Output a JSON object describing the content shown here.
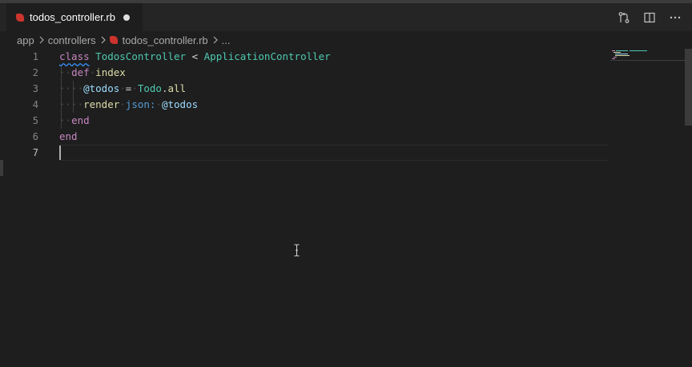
{
  "tab": {
    "title": "todos_controller.rb",
    "file_icon": "ruby-icon",
    "dirty_icon": "unsaved-dot-icon"
  },
  "toolbar": {
    "icons": [
      "open-changes-icon",
      "split-editor-icon",
      "more-actions-icon"
    ]
  },
  "breadcrumbs": {
    "items": [
      "app",
      "controllers",
      "todos_controller.rb",
      "..."
    ],
    "separator_icon": "chevron-right-icon"
  },
  "editor": {
    "line_numbers": [
      "1",
      "2",
      "3",
      "4",
      "5",
      "6",
      "7"
    ],
    "active_line": "7",
    "lines": [
      [
        {
          "t": "class",
          "c": "kw kw-squiggle"
        },
        {
          "t": " ",
          "c": "ws"
        },
        {
          "t": "TodosController",
          "c": "cls"
        },
        {
          "t": " ",
          "c": "ws"
        },
        {
          "t": "<",
          "c": "op"
        },
        {
          "t": " ",
          "c": "ws"
        },
        {
          "t": "ApplicationController",
          "c": "cls"
        }
      ],
      [
        {
          "t": "··",
          "c": "ws"
        },
        {
          "t": "def",
          "c": "kw"
        },
        {
          "t": "·",
          "c": "ws"
        },
        {
          "t": "index",
          "c": "fn"
        }
      ],
      [
        {
          "t": "····",
          "c": "ws"
        },
        {
          "t": "@todos",
          "c": "ivar"
        },
        {
          "t": "·",
          "c": "ws"
        },
        {
          "t": "=",
          "c": "op"
        },
        {
          "t": "·",
          "c": "ws"
        },
        {
          "t": "Todo",
          "c": "cls"
        },
        {
          "t": ".",
          "c": "plain"
        },
        {
          "t": "all",
          "c": "fn"
        }
      ],
      [
        {
          "t": "····",
          "c": "ws"
        },
        {
          "t": "render",
          "c": "fn"
        },
        {
          "t": "·",
          "c": "ws"
        },
        {
          "t": "json:",
          "c": "sym"
        },
        {
          "t": "·",
          "c": "ws"
        },
        {
          "t": "@todos",
          "c": "ivar"
        }
      ],
      [
        {
          "t": "··",
          "c": "ws"
        },
        {
          "t": "end",
          "c": "kw"
        }
      ],
      [
        {
          "t": "end",
          "c": "kw"
        }
      ],
      []
    ]
  },
  "colors": {
    "editor_bg": "#1e1e1e",
    "tabbar_bg": "#252526",
    "keyword": "#c586c0",
    "class_name": "#4ec9b0",
    "function": "#dcdcaa",
    "ivar": "#9cdcfe",
    "symbol": "#569cd6",
    "ruby_red": "#cc342d"
  }
}
